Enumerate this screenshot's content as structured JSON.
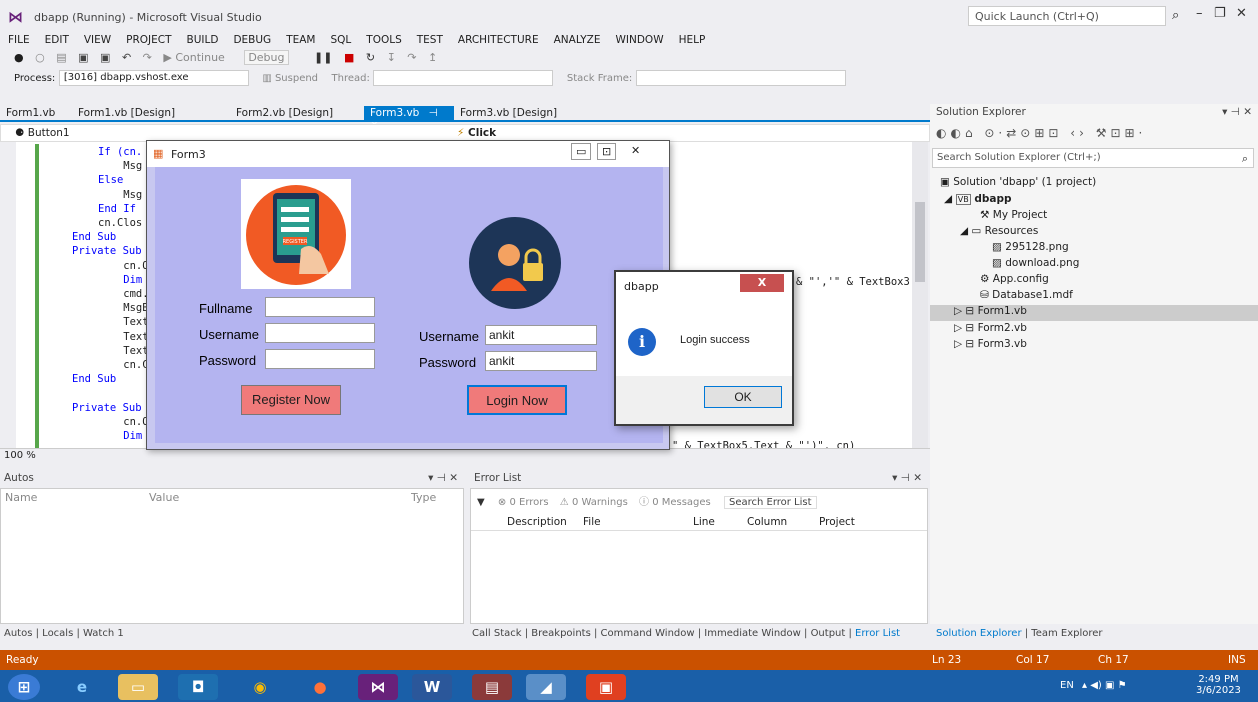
{
  "window": {
    "title": "dbapp (Running) - Microsoft Visual Studio",
    "quick_launch_placeholder": "Quick Launch (Ctrl+Q)"
  },
  "menu": [
    "FILE",
    "EDIT",
    "VIEW",
    "PROJECT",
    "BUILD",
    "DEBUG",
    "TEAM",
    "SQL",
    "TOOLS",
    "TEST",
    "ARCHITECTURE",
    "ANALYZE",
    "WINDOW",
    "HELP"
  ],
  "toolbar": {
    "continue_label": "Continue",
    "config_label": "Debug",
    "suspend_label": "Suspend",
    "thread_label": "Thread:",
    "stackframe_label": "Stack Frame:",
    "process_label": "Process:",
    "process_value": "[3016] dbapp.vshost.exe"
  },
  "tabs": [
    "Form1.vb",
    "Form1.vb [Design]",
    "Form2.vb [Design]",
    "Form3.vb",
    "Form3.vb [Design]"
  ],
  "nav": {
    "left": "Button1",
    "right": "Click"
  },
  "code_lines": [
    "If (cn.",
    "    Msg",
    "Else",
    "    Msg",
    "End If",
    "cn.Clos",
    "End Sub",
    "Private Sub",
    "    cn.Open",
    "    Dim cmd",
    "    cmd.Exe",
    "    MsgBox(",
    "    TextBox",
    "    TextBox",
    "    TextBox",
    "    cn.Clos",
    "End Sub",
    "",
    "Private Sub",
    "    cn.Open",
    "    Dim cmd"
  ],
  "code_fragments": {
    "line_a": "& \"','\" & TextBox3",
    "line_b": "\" & TextBox5.Text & \"')\", cn)"
  },
  "zoom": "100 %",
  "autos": {
    "title": "Autos",
    "col_name": "Name",
    "col_value": "Value",
    "col_type": "Type"
  },
  "error_list": {
    "title": "Error List",
    "errors": "0 Errors",
    "warnings": "0 Warnings",
    "messages": "0 Messages",
    "search_placeholder": "Search Error List",
    "columns": [
      "Description",
      "File",
      "Line",
      "Column",
      "Project"
    ]
  },
  "bottom_left_tabs": [
    "Autos",
    "Locals",
    "Watch 1"
  ],
  "bottom_right_tabs": [
    "Call Stack",
    "Breakpoints",
    "Command Window",
    "Immediate Window",
    "Output",
    "Error List"
  ],
  "solution_explorer": {
    "title": "Solution Explorer",
    "search_placeholder": "Search Solution Explorer (Ctrl+;)",
    "items": [
      {
        "label": "Solution 'dbapp' (1 project)",
        "indent": 0
      },
      {
        "label": "dbapp",
        "indent": 1
      },
      {
        "label": "My Project",
        "indent": 2
      },
      {
        "label": "Resources",
        "indent": 2
      },
      {
        "label": "295128.png",
        "indent": 3
      },
      {
        "label": "download.png",
        "indent": 3
      },
      {
        "label": "App.config",
        "indent": 2
      },
      {
        "label": "Database1.mdf",
        "indent": 2
      },
      {
        "label": "Form1.vb",
        "indent": 2
      },
      {
        "label": "Form2.vb",
        "indent": 2
      },
      {
        "label": "Form3.vb",
        "indent": 2
      }
    ],
    "bottom_tabs": [
      "Solution Explorer",
      "Team Explorer"
    ]
  },
  "status": {
    "ready": "Ready",
    "ln": "Ln 23",
    "col": "Col 17",
    "ch": "Ch 17",
    "ins": "INS"
  },
  "clock": {
    "time": "2:49 PM",
    "date": "3/6/2023",
    "lang": "EN"
  },
  "form3": {
    "title": "Form3",
    "fullname_label": "Fullname",
    "username_label": "Username",
    "password_label": "Password",
    "register_button": "Register Now",
    "login_username_label": "Username",
    "login_username_value": "ankit",
    "login_password_label": "Password",
    "login_password_value": "ankit",
    "login_button": "Login Now",
    "register_image_text": "REGISTER"
  },
  "msgbox": {
    "title": "dbapp",
    "text": "Login success",
    "ok": "OK",
    "close": "X"
  }
}
